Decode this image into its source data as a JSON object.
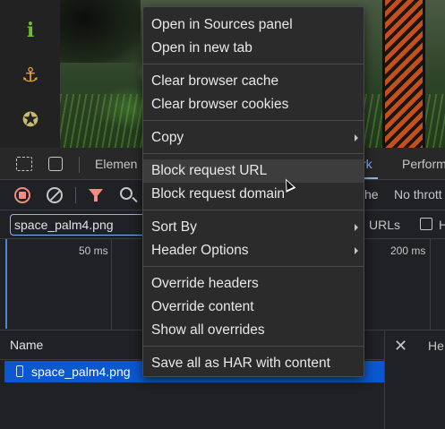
{
  "page": {
    "rail_icons": [
      "info-icon",
      "anchor-icon",
      "award-icon"
    ],
    "accent_colors": {
      "info": "#6fbf2c",
      "anchor": "#e8a23a",
      "award": "#c8bd6a"
    }
  },
  "devtools": {
    "tabs": {
      "elements": "Elemen",
      "network": "rk",
      "performance": "Perform"
    },
    "toolbar": {
      "disable_cache_fragment": "che",
      "throttling_fragment": "No thrott"
    },
    "filter": {
      "value": "space_palm4.png",
      "urls_label": "URLs",
      "hide_label": "H"
    },
    "timeline": {
      "labels": [
        "50 ms",
        "200 ms"
      ]
    },
    "table": {
      "name_header": "Name",
      "details_tab_fragment": "He",
      "close_symbol": "✕"
    },
    "requests": [
      {
        "name": "space_palm4.png"
      }
    ],
    "colors": {
      "selected_row": "#0b57d0",
      "accent": "#8ab4f8",
      "record": "#f28b82"
    }
  },
  "context_menu": {
    "groups": [
      [
        {
          "label": "Open in Sources panel"
        },
        {
          "label": "Open in new tab"
        }
      ],
      [
        {
          "label": "Clear browser cache"
        },
        {
          "label": "Clear browser cookies"
        }
      ],
      [
        {
          "label": "Copy",
          "submenu": true
        }
      ],
      [
        {
          "label": "Block request URL",
          "highlighted": true
        },
        {
          "label": "Block request domain"
        }
      ],
      [
        {
          "label": "Sort By",
          "submenu": true
        },
        {
          "label": "Header Options",
          "submenu": true
        }
      ],
      [
        {
          "label": "Override headers"
        },
        {
          "label": "Override content"
        },
        {
          "label": "Show all overrides"
        }
      ],
      [
        {
          "label": "Save all as HAR with content"
        }
      ]
    ]
  }
}
